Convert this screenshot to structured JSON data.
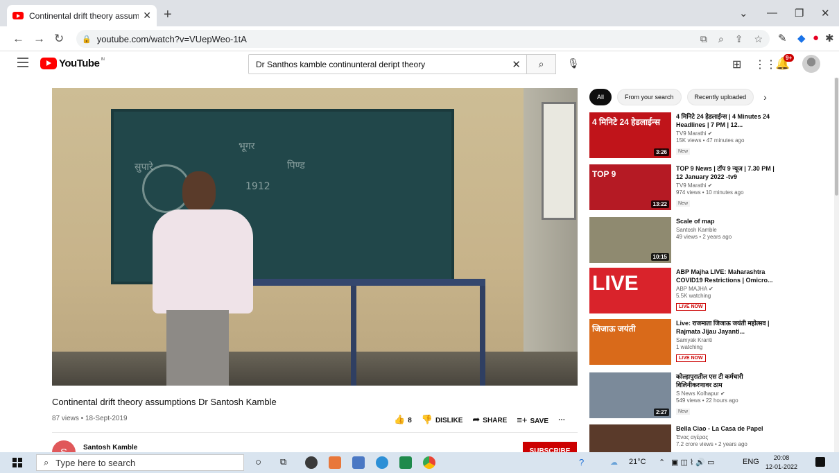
{
  "browser": {
    "tab_title": "Continental drift theory assumptions Dr Santosh Kamble",
    "tab_close": "✕",
    "new_tab": "+",
    "url": "youtube.com/watch?v=VUepWeo-1tA"
  },
  "youtube": {
    "logo_text": "YouTube",
    "country": "IN",
    "search_query": "Dr Santhos kamble continunteral deript theory",
    "notification_count": "9+"
  },
  "video": {
    "title": "Continental drift theory assumptions Dr Santosh Kamble",
    "meta": "87 views • 18-Sept-2019",
    "like_count": "8",
    "dislike_label": "DISLIKE",
    "share_label": "SHARE",
    "save_label": "SAVE",
    "channel_name": "Santosh Kamble",
    "channel_initial": "S",
    "subscribe_label": "SUBSCRIBE",
    "chalk": [
      "भूगर",
      "सुपारे",
      "पिण्ड",
      "1912"
    ]
  },
  "chips": [
    "All",
    "From your search",
    "Recently uploaded"
  ],
  "recommendations": [
    {
      "title": "4 मिनिटे 24 हेडलाईन्स | 4 Minutes 24 Headlines | 7 PM | 12...",
      "channel": "TV9 Marathi ✔",
      "views": "15K views • 47 minutes ago",
      "tag": "New",
      "duration": "3:26",
      "thumb_text": "4 मिनिटे 24 हेडलाईन्स",
      "thumb_color": "#c0141a"
    },
    {
      "title": "TOP 9 News | टॉप 9 न्यूज | 7.30 PM | 12 January 2022 -tv9",
      "channel": "TV9 Marathi ✔",
      "views": "974 views • 10 minutes ago",
      "tag": "New",
      "duration": "13:22",
      "thumb_text": "TOP 9",
      "thumb_color": "#b51a24"
    },
    {
      "title": "Scale of map",
      "channel": "Santosh Kamble",
      "views": "49 views • 2 years ago",
      "tag": "",
      "duration": "10:15",
      "thumb_text": "",
      "thumb_color": "#8f8a70"
    },
    {
      "title": "ABP Majha LIVE: Maharashtra COVID19 Restrictions | Omicro...",
      "channel": "ABP MAJHA ✔",
      "views": "5.5K watching",
      "tag": "LIVE NOW",
      "duration": "",
      "thumb_text": "LIVE",
      "thumb_color": "#d9232b"
    },
    {
      "title": "Live: राजमाता जिजाऊ जयंती महोत्सव | Rajmata Jijau Jayanti...",
      "channel": "Samyak Kranti",
      "views": "1 watching",
      "tag": "LIVE NOW",
      "duration": "",
      "thumb_text": "जिजाऊ जयंती",
      "thumb_color": "#d96a1a"
    },
    {
      "title": "कोल्हापुरातील एस टी कर्मचारी विलिनीकरणावर ठाम",
      "channel": "S News Kolhapur ✔",
      "views": "549 views • 22 hours ago",
      "tag": "New",
      "duration": "2:27",
      "thumb_text": "",
      "thumb_color": "#7b8a9a"
    },
    {
      "title": "Bella Ciao - La Casa de Papel",
      "channel": "Ένας αγέρας",
      "views": "7.2 crore views • 2 years ago",
      "tag": "",
      "duration": "",
      "thumb_text": "",
      "thumb_color": "#5a3a2a"
    }
  ],
  "taskbar": {
    "search_placeholder": "Type here to search",
    "temperature": "21°C",
    "lang": "ENG",
    "time": "20:08",
    "date": "12-01-2022"
  }
}
